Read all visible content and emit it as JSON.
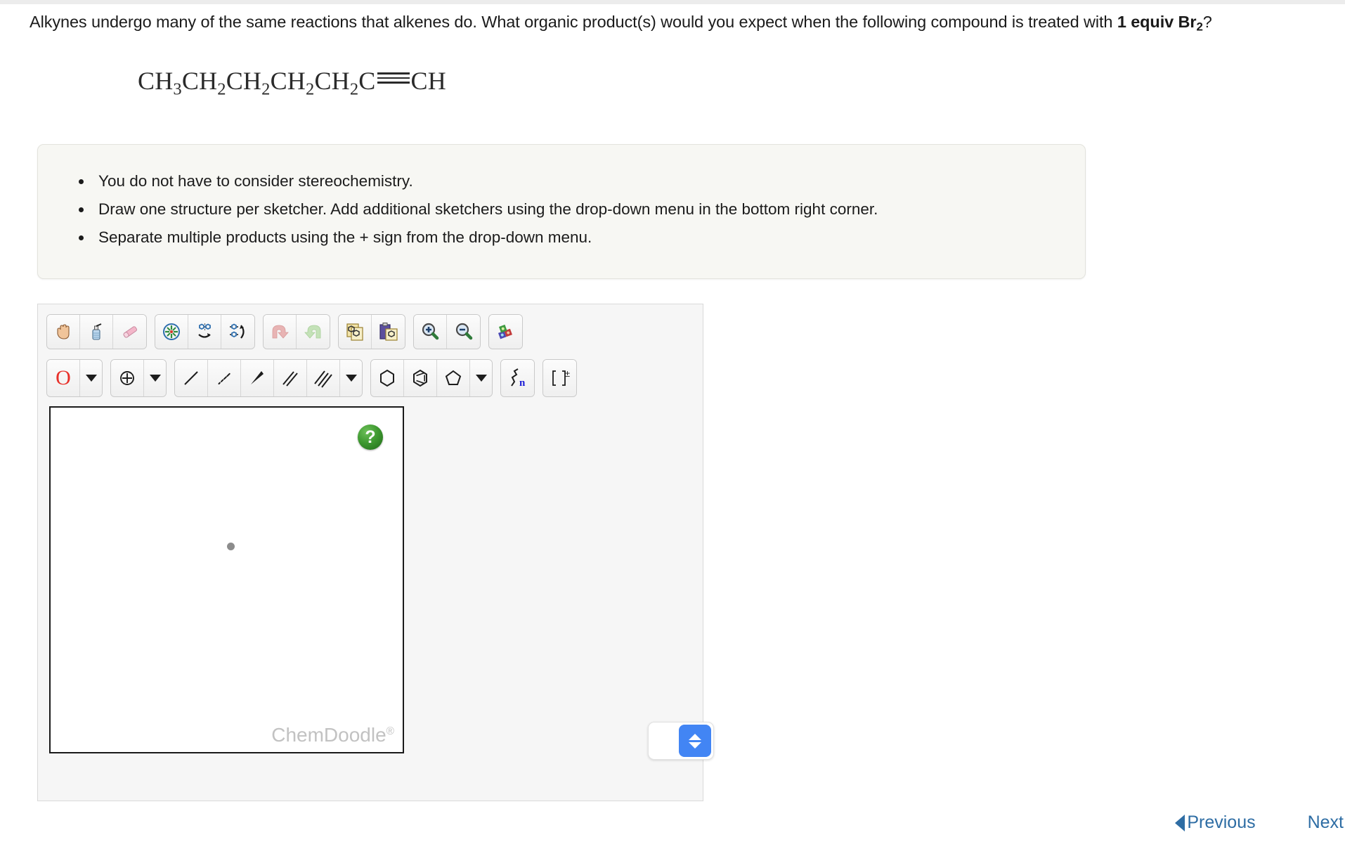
{
  "question": {
    "part1": "Alkynes undergo many of the same reactions that alkenes do. What organic product(s) would you expect when the following compound is treated with ",
    "bold_lead": "1 equiv Br",
    "bold_sub": "2",
    "tail": "?"
  },
  "formula": {
    "segments": [
      "CH",
      "3",
      "CH",
      "2",
      "CH",
      "2",
      "CH",
      "2",
      "CH",
      "2",
      "C"
    ],
    "bond": "triple-bond",
    "terminal": "CH",
    "plain_text": "CH3CH2CH2CH2CH2C≡CH"
  },
  "instructions": {
    "items": [
      "You do not have to consider stereochemistry.",
      "Draw one structure per sketcher. Add additional sketchers using the drop-down menu in the bottom right corner.",
      "Separate multiple products using the + sign from the drop-down menu."
    ]
  },
  "sketcher": {
    "toolbar_row1": [
      {
        "name": "pan-hand-icon",
        "label": "Move / Pan"
      },
      {
        "name": "erase-all-icon",
        "label": "Clear"
      },
      {
        "name": "eraser-icon",
        "label": "Erase"
      },
      {
        "name": "center-structure-icon",
        "label": "Center"
      },
      {
        "name": "flip-horizontal-icon",
        "label": "Flip Horizontal"
      },
      {
        "name": "flip-vertical-icon",
        "label": "Flip Vertical"
      },
      {
        "name": "undo-icon",
        "label": "Undo"
      },
      {
        "name": "redo-icon",
        "label": "Redo"
      },
      {
        "name": "copy-icon",
        "label": "Copy"
      },
      {
        "name": "paste-icon",
        "label": "Paste"
      },
      {
        "name": "zoom-in-icon",
        "label": "Zoom In"
      },
      {
        "name": "zoom-out-icon",
        "label": "Zoom Out"
      },
      {
        "name": "periodic-table-icon",
        "label": "Periodic Table"
      }
    ],
    "toolbar_row2": [
      {
        "name": "oxygen-atom-label",
        "label": "O"
      },
      {
        "name": "atom-dropdown-caret",
        "label": "▾"
      },
      {
        "name": "charge-icon",
        "label": "Charge"
      },
      {
        "name": "charge-dropdown-caret",
        "label": "▾"
      },
      {
        "name": "single-bond-icon",
        "label": "Single Bond"
      },
      {
        "name": "hashed-bond-icon",
        "label": "Hashed Bond"
      },
      {
        "name": "wedge-bond-icon",
        "label": "Wedge Bond"
      },
      {
        "name": "double-bond-icon",
        "label": "Double Bond"
      },
      {
        "name": "triple-bond-icon",
        "label": "Triple Bond"
      },
      {
        "name": "bond-dropdown-caret",
        "label": "▾"
      },
      {
        "name": "cyclohexane-ring-icon",
        "label": "Cyclohexane"
      },
      {
        "name": "benzene-ring-icon",
        "label": "Benzene"
      },
      {
        "name": "cyclopentane-ring-icon",
        "label": "Cyclopentane"
      },
      {
        "name": "ring-dropdown-caret",
        "label": "▾"
      },
      {
        "name": "repeat-unit-icon",
        "label": "n"
      },
      {
        "name": "bracket-charge-icon",
        "label": "[ ]±"
      }
    ],
    "canvas": {
      "help_label": "?",
      "watermark": "ChemDoodle",
      "watermark_mark": "®"
    },
    "stepper": {
      "value": "",
      "up_label": "▲",
      "down_label": "▼"
    }
  },
  "footer": {
    "previous_label": "Previous",
    "next_label": "Next"
  },
  "colors": {
    "accent_blue": "#4285f4",
    "link_blue": "#2e6da4",
    "oxygen_red": "#e8312a",
    "help_green": "#3f9a31",
    "panel_bg": "#f6f6f6",
    "instruction_bg": "#f7f7f3"
  }
}
